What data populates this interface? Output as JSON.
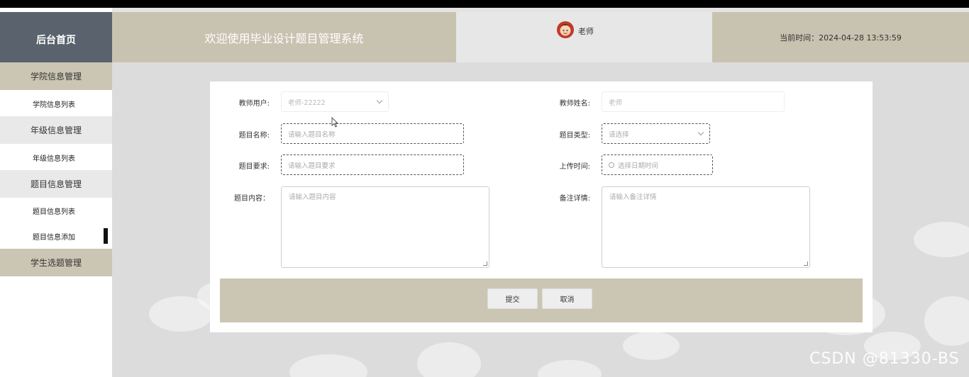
{
  "sidebar": {
    "brand": "后台首页",
    "sections": [
      {
        "label": "学院信息管理",
        "items": [
          "学院信息列表"
        ]
      },
      {
        "label": "年级信息管理",
        "items": [
          "年级信息列表"
        ]
      },
      {
        "label": "题目信息管理",
        "items": [
          "题目信息列表",
          "题目信息添加"
        ]
      },
      {
        "label": "学生选题管理",
        "items": []
      }
    ],
    "active_item": "题目信息添加"
  },
  "header": {
    "title": "欢迎使用毕业设计题目管理系统",
    "user_name": "老师",
    "time_label": "当前时间：2024-04-28 13:53:59"
  },
  "form": {
    "teacher_user": {
      "label": "教师用户:",
      "value": "老师-22222"
    },
    "teacher_name": {
      "label": "教师姓名:",
      "value": "老师"
    },
    "topic_name": {
      "label": "题目名称:",
      "placeholder": "请输入题目名称"
    },
    "topic_type": {
      "label": "题目类型:",
      "placeholder": "请选择"
    },
    "topic_requirement": {
      "label": "题目要求:",
      "placeholder": "请输入题目要求"
    },
    "upload_time": {
      "label": "上传时间:",
      "placeholder": "选择日期时间"
    },
    "topic_content": {
      "label": "题目内容：",
      "placeholder": "请输入题目内容"
    },
    "remarks": {
      "label": "备注详情:",
      "placeholder": "请输入备注详情"
    },
    "submit_label": "提交",
    "cancel_label": "取消"
  },
  "watermark": "CSDN @81330-BS",
  "colors": {
    "brand_bg": "#5a626d",
    "accent_beige": "#c8c2b0",
    "section_beige": "#cbc5b3"
  }
}
